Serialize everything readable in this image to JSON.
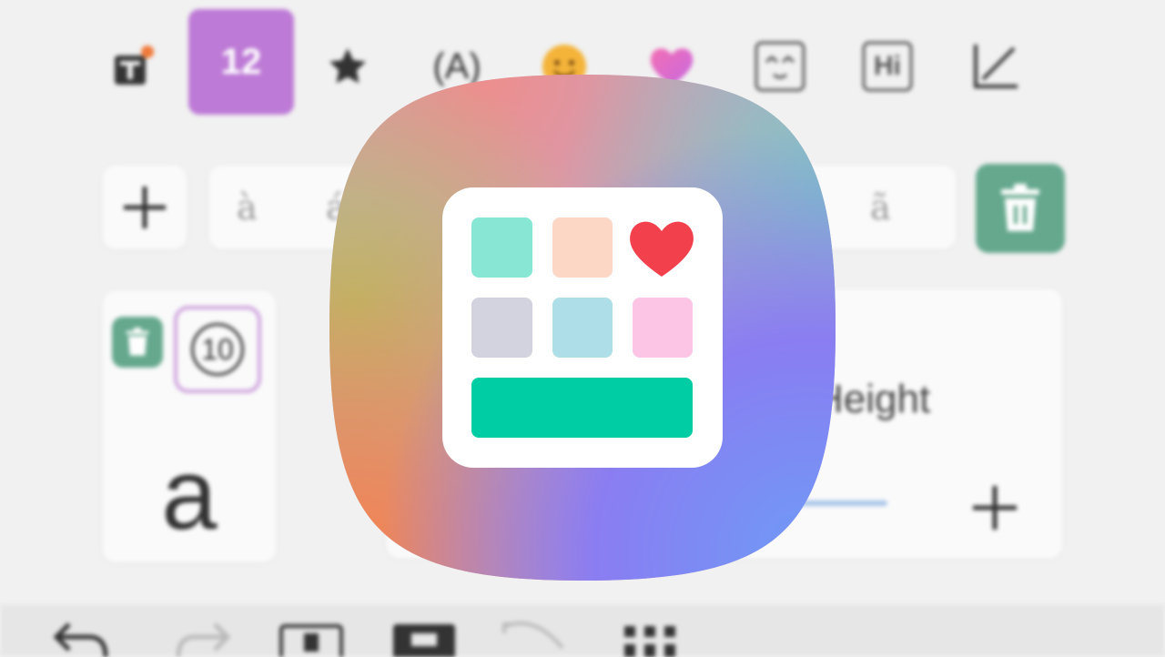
{
  "toolbar": {
    "number_tab": "12",
    "text_face_label": "(A)",
    "hi_label": "Hi"
  },
  "accents": {
    "left_1": "à",
    "left_2": "á",
    "right_1": "ã"
  },
  "preview": {
    "circled_number": "10",
    "letter": "a"
  },
  "height_panel": {
    "label": "Height",
    "label_visible": "Height"
  },
  "icons": [
    "text-format-icon",
    "star-icon",
    "text-in-circle-icon",
    "emoji-icon",
    "heart-icon",
    "kaomoji-icon",
    "hi-text-icon",
    "angle-tool-icon",
    "add-icon",
    "trash-icon",
    "undo-icon",
    "redo-icon",
    "screenshot-icon",
    "keyboard-icon",
    "rotate-icon",
    "grid-icon",
    "keys-cafe-app-icon"
  ],
  "colors": {
    "number_tab": "#bd7ad6",
    "trash_button": "#65a88e",
    "slider": "#a8c4ea",
    "tile_green": "#87e6d4",
    "tile_peach": "#fdd7c5",
    "tile_heart": "#f2414c",
    "tile_gray": "#d2d3df",
    "tile_blue": "#aedfe9",
    "tile_pink": "#fcc5e6",
    "space_bar": "#00cda4"
  }
}
